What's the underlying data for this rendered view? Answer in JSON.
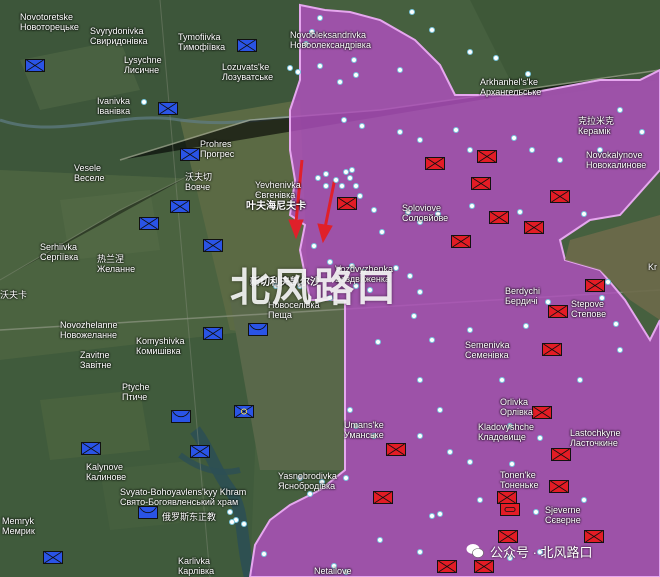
{
  "map": {
    "colors": {
      "occupied_zone": "#b14fbf",
      "occupied_border": "#e6a7ef",
      "ua_unit": "#2a54e6",
      "ru_unit": "#e31c25",
      "arrow": "#e0202a"
    },
    "watermark": "北风路口",
    "badge": "公众号 · 北风路口",
    "annotations": {
      "yevhenivka_cn": "叶夫海尼夫卡",
      "vozdvyzhenka_cn": "新切利夫凯尔沙"
    },
    "places": [
      {
        "id": "novotoretske",
        "latin": "Novotoretske",
        "ua": "Новоторецьке"
      },
      {
        "id": "svyrydonivka",
        "latin": "Svyrydonivka",
        "ua": "Свиридонівка"
      },
      {
        "id": "tymofiivka",
        "latin": "Tymofiivka",
        "ua": "Тимофіївка"
      },
      {
        "id": "novooleksandrivka",
        "latin": "Novooleksandrivka",
        "ua": "Новоолександрівка"
      },
      {
        "id": "lysychne",
        "latin": "Lysychne",
        "ua": "Лисичне"
      },
      {
        "id": "lozuvatske",
        "latin": "Lozuvats'ke",
        "ua": "Лозуватське"
      },
      {
        "id": "arkhanhelske",
        "latin": "Arkhanhel's'ke",
        "ua": "Архангельське"
      },
      {
        "id": "ivanivka",
        "latin": "Ivanivka",
        "ua": "Іванівка"
      },
      {
        "id": "keramik",
        "latin": "克拉米克",
        "ua": "Керамік"
      },
      {
        "id": "prohres",
        "latin": "Prohres",
        "ua": "Прогрес"
      },
      {
        "id": "novokalynove",
        "latin": "Novokalynove",
        "ua": "Новокалинове"
      },
      {
        "id": "vesele",
        "latin": "Vesele",
        "ua": "Веселе"
      },
      {
        "id": "vovche",
        "latin": "沃夫切",
        "ua": "Вовче"
      },
      {
        "id": "yevhenivka",
        "latin": "Yevhenivka",
        "ua": "Євгенівка"
      },
      {
        "id": "solovyove",
        "latin": "Soloviove",
        "ua": "Соловйове"
      },
      {
        "id": "serhiivka",
        "latin": "Serhiivka",
        "ua": "Сергіївка"
      },
      {
        "id": "zhelanne",
        "latin": "热兰涅",
        "ua": "Желанне"
      },
      {
        "id": "vozdvyzhenka",
        "latin": "Vozdvyzhenka",
        "ua": "Воздвиженка"
      },
      {
        "id": "berdychi",
        "latin": "Berdychi",
        "ua": "Бердичі"
      },
      {
        "id": "stepove",
        "latin": "Stepove",
        "ua": "Степове"
      },
      {
        "id": "novozhelanne",
        "latin": "Novozhelanne",
        "ua": "Новожеланне"
      },
      {
        "id": "komyshivka",
        "latin": "Komyshivka",
        "ua": "Комишівка"
      },
      {
        "id": "novoselivka",
        "latin": "Novoselivka",
        "ua": "Новоселівка"
      },
      {
        "id": "peshcha",
        "latin": "Пещa",
        "ua": "Пещa"
      },
      {
        "id": "semenivka",
        "latin": "Semenivka",
        "ua": "Семенівка"
      },
      {
        "id": "zavitne",
        "latin": "Zavitne",
        "ua": "Завітне"
      },
      {
        "id": "ptyche",
        "latin": "Ptyche",
        "ua": "Птичe"
      },
      {
        "id": "orlivka",
        "latin": "Orlivka",
        "ua": "Орлівка"
      },
      {
        "id": "umanske",
        "latin": "Umans'ke",
        "ua": "Уманське"
      },
      {
        "id": "kladovyshche",
        "latin": "Kladovyshche",
        "ua": "Кладовище"
      },
      {
        "id": "lastochkyne",
        "latin": "Lastochkyne",
        "ua": "Ласточкине"
      },
      {
        "id": "kalynove",
        "latin": "Kalynove",
        "ua": "Калинове"
      },
      {
        "id": "tonenke",
        "latin": "Tonen'ke",
        "ua": "Тоненьке"
      },
      {
        "id": "yasnobrodivka",
        "latin": "Yasnobrodivka",
        "ua": "Яснобродівка"
      },
      {
        "id": "khram",
        "latin": "Svyato-Bohoyavlens'kyy Khram",
        "ua": "Свято-Богоявленський храм"
      },
      {
        "id": "church_cn",
        "latin": "俄罗斯东正教",
        "ua": "храм"
      },
      {
        "id": "sjeverne",
        "latin": "Sjeverne",
        "ua": "Сєверне"
      },
      {
        "id": "memryk",
        "latin": "Memryk",
        "ua": "Мемрик"
      },
      {
        "id": "karlivka",
        "latin": "Karlivka",
        "ua": "Карлівка"
      },
      {
        "id": "netailove",
        "latin": "Netailove",
        "ua": ""
      },
      {
        "id": "kr",
        "latin": "Kr",
        "ua": ""
      },
      {
        "id": "rift_cn",
        "latin": "沃",
        "ua": ""
      },
      {
        "id": "westedge",
        "latin": "沃夫卡",
        "ua": ""
      }
    ]
  }
}
